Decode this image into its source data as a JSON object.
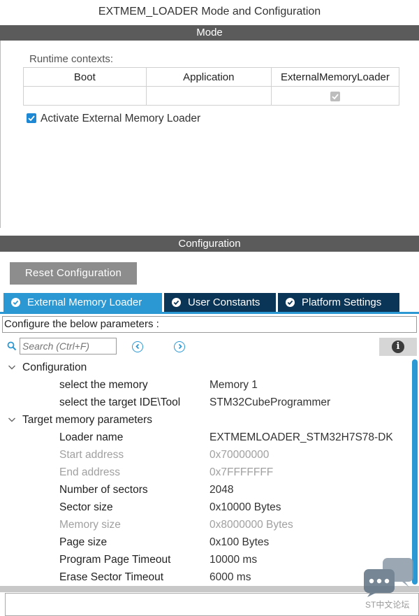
{
  "window": {
    "title": "EXTMEM_LOADER Mode and Configuration"
  },
  "mode": {
    "header": "Mode",
    "runtime_label": "Runtime contexts:",
    "columns": [
      "Boot",
      "Application",
      "ExternalMemoryLoader"
    ],
    "activate_label": "Activate External Memory Loader"
  },
  "configuration": {
    "header": "Configuration",
    "reset_label": "Reset Configuration",
    "tabs": [
      {
        "label": "External Memory Loader"
      },
      {
        "label": "User Constants"
      },
      {
        "label": "Platform Settings"
      }
    ],
    "params_caption": "Configure the below parameters :",
    "search_placeholder": "Search (Ctrl+F)",
    "groups": [
      {
        "label": "Configuration",
        "params": [
          {
            "name": "select the memory",
            "value": "Memory 1"
          },
          {
            "name": "select the target IDE\\Tool",
            "value": "STM32CubeProgrammer"
          }
        ]
      },
      {
        "label": "Target memory parameters",
        "params": [
          {
            "name": "Loader name",
            "value": "EXTMEMLOADER_STM32H7S78-DK"
          },
          {
            "name": "Start address",
            "value": "0x70000000"
          },
          {
            "name": "End address",
            "value": "0x7FFFFFFF"
          },
          {
            "name": "Number of sectors",
            "value": "2048"
          },
          {
            "name": "Sector size",
            "value": "0x10000 Bytes"
          },
          {
            "name": "Memory size",
            "value": "0x8000000 Bytes"
          },
          {
            "name": "Page size",
            "value": "0x100 Bytes"
          },
          {
            "name": "Program Page Timeout",
            "value": "10000 ms"
          },
          {
            "name": "Erase Sector Timeout",
            "value": "6000 ms"
          }
        ]
      }
    ]
  },
  "watermark": {
    "text": "ST中文论坛"
  },
  "colors": {
    "accent": "#2b98d4",
    "header_bg": "#5b5b5b",
    "tab_dark": "#0b3556",
    "button_grey": "#8d8d8d"
  }
}
